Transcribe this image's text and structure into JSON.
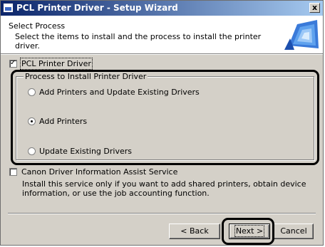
{
  "window": {
    "title": "PCL Printer Driver - Setup Wizard",
    "close_glyph": "x"
  },
  "header": {
    "title": "Select Process",
    "description": "Select the items to install and the process to install the printer driver."
  },
  "pcl_checkbox": {
    "label": "PCL Printer Driver",
    "checked": true
  },
  "process_group": {
    "legend": "Process to Install Printer Driver",
    "options": [
      {
        "label": "Add Printers and Update Existing Drivers",
        "selected": false
      },
      {
        "label": "Add Printers",
        "selected": true
      },
      {
        "label": "Update Existing Drivers",
        "selected": false
      }
    ]
  },
  "canon_checkbox": {
    "label": "Canon Driver Information Assist Service",
    "checked": false,
    "info": "Install this service only if you want to add shared printers, obtain device information, or use the job accounting function."
  },
  "buttons": {
    "back": "< Back",
    "next": "Next >",
    "cancel": "Cancel"
  },
  "icons": {
    "title": "setup-app-icon",
    "check": "checkmark-icon",
    "header_art": "printer-wizard-graphic"
  }
}
